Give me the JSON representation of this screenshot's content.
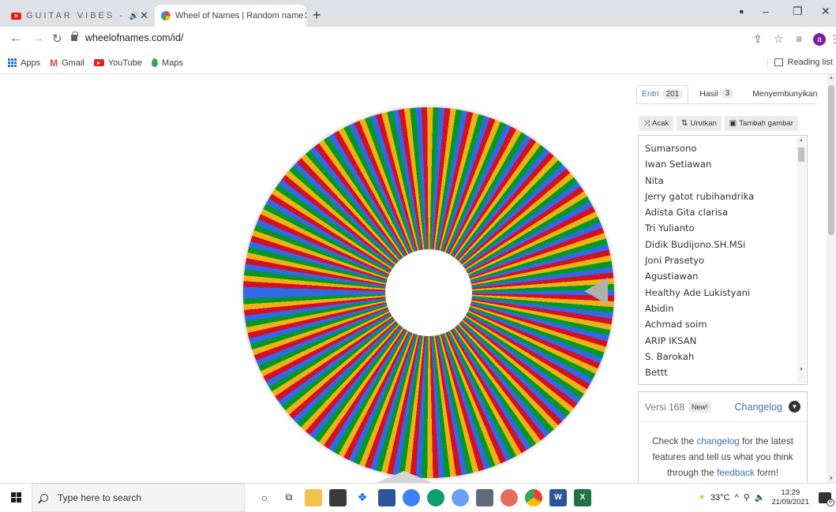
{
  "browser": {
    "tabs": [
      {
        "title": "GUITAR VIBES -",
        "audio_icon": "🔊",
        "close": "✕"
      },
      {
        "title": "Wheel of Names | Random name",
        "close": "✕"
      }
    ],
    "new_tab": "+",
    "window_controls": {
      "minimize": "–",
      "maximize": "❐",
      "close": "✕"
    },
    "address": "wheelofnames.com/id/",
    "profile_initial": "a",
    "bookmarks": [
      "Apps",
      "Gmail",
      "YouTube",
      "Maps"
    ],
    "reading_list": "Reading list"
  },
  "wheel": {
    "segment_colors": [
      "#3369e8",
      "#d50f25",
      "#eeb211",
      "#009925"
    ]
  },
  "panel": {
    "tabs": [
      {
        "label": "Entri",
        "count": "201"
      },
      {
        "label": "Hasil",
        "count": "3"
      },
      {
        "label": "Menyembunyikan",
        "count": ""
      }
    ],
    "tools": [
      {
        "icon": "⤨",
        "label": "Acak"
      },
      {
        "icon": "⇅",
        "label": "Urutkan"
      },
      {
        "icon": "▣",
        "label": "Tambah gambar"
      }
    ],
    "entries": [
      "Sumarsono",
      "Iwan Setiawan",
      "Nita",
      "Jerry gatot rubihandrika",
      "Adista Gita clarisa",
      "Tri Yulianto",
      "Didik Budijono.SH.MSi",
      "Joni Prasetyo",
      "Agustiawan",
      "Healthy Ade Lukistyani",
      "Abidin",
      "Achmad soim",
      "ARIP IKSAN",
      "S. Barokah",
      "Bettt"
    ],
    "changelog": {
      "version": "Versi 168",
      "new_badge": "New!",
      "link": "Changelog",
      "text_1": "Check the ",
      "link_1": "changelog",
      "text_2": " for the latest features and tell us what you think through the ",
      "link_2": "feedback",
      "text_3": " form!"
    }
  },
  "taskbar": {
    "search_placeholder": "Type here to search",
    "weather": "33°C",
    "time": "13:29",
    "date": "21/09/2021",
    "notifications": "6"
  }
}
